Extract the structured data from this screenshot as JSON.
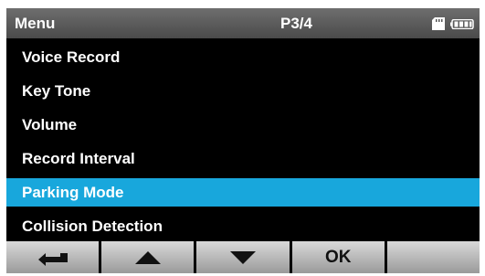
{
  "header": {
    "title": "Menu",
    "page": "P3/4",
    "icons": [
      "sd-card-icon",
      "battery-icon"
    ]
  },
  "menu": {
    "items": [
      {
        "label": "Voice Record",
        "selected": false
      },
      {
        "label": "Key Tone",
        "selected": false
      },
      {
        "label": "Volume",
        "selected": false
      },
      {
        "label": "Record Interval",
        "selected": false
      },
      {
        "label": "Parking Mode",
        "selected": true
      },
      {
        "label": "Collision Detection",
        "selected": false
      }
    ]
  },
  "toolbar": {
    "back_icon": "return-arrow-icon",
    "up_icon": "up-triangle-icon",
    "down_icon": "down-triangle-icon",
    "ok_label": "OK"
  },
  "colors": {
    "selected_highlight": "#18a7dc",
    "header_bg": "#5a5a5a",
    "background": "#000000"
  }
}
